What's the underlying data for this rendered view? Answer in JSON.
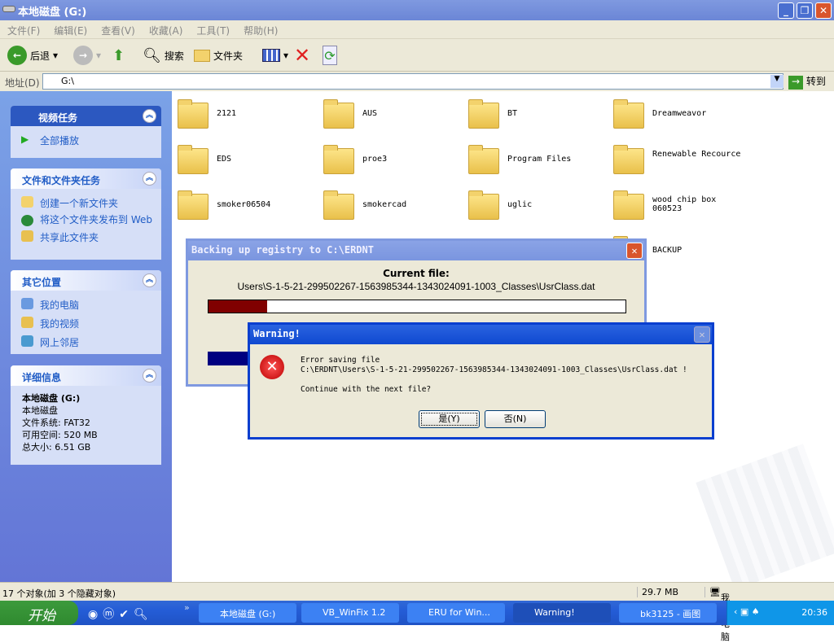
{
  "window": {
    "title": "本地磁盘 (G:)"
  },
  "menu": [
    "文件(F)",
    "编辑(E)",
    "查看(V)",
    "收藏(A)",
    "工具(T)",
    "帮助(H)"
  ],
  "toolbar": {
    "back": "后退",
    "search": "搜索",
    "folders": "文件夹"
  },
  "address": {
    "label": "地址(D)",
    "value": "G:\\",
    "go": "转到"
  },
  "sidebar": {
    "video_tasks": {
      "title": "视频任务",
      "items": [
        "全部播放"
      ]
    },
    "file_tasks": {
      "title": "文件和文件夹任务",
      "items": [
        "创建一个新文件夹",
        "将这个文件夹发布到 Web",
        "共享此文件夹"
      ]
    },
    "other_places": {
      "title": "其它位置",
      "items": [
        "我的电脑",
        "我的视频",
        "网上邻居"
      ]
    },
    "details": {
      "title": "详细信息",
      "name": "本地磁盘 (G:)",
      "type": "本地磁盘",
      "fs": "文件系统: FAT32",
      "free": "可用空间: 520 MB",
      "total": "总大小: 6.51 GB"
    }
  },
  "folders": [
    "2121",
    "AUS",
    "BT",
    "Dreamweavor",
    "EDS",
    "proe3",
    "Program Files",
    "Renewable Recource",
    "smoker06504",
    "smokercad",
    "uglic",
    "wood chip box 060523",
    "BACKUP"
  ],
  "backup_dialog": {
    "title": "Backing up registry to C:\\ERDNT",
    "current_label": "Current file:",
    "current_file": "Users\\S-1-5-21-299502267-1563985344-1343024091-1003_Classes\\UsrClass.dat",
    "progress_percent": 14
  },
  "warning_dialog": {
    "title": "Warning!",
    "line1": "Error saving file",
    "line2": "C:\\ERDNT\\Users\\S-1-5-21-299502267-1563985344-1343024091-1003_Classes\\UsrClass.dat !",
    "line3": "Continue with the next file?",
    "yes": "是(Y)",
    "no": "否(N)"
  },
  "status": {
    "objects": "17 个对象(加 3 个隐藏对象)",
    "size": "29.7 MB",
    "location": "我的电脑"
  },
  "taskbar": {
    "start": "开始",
    "tasks": [
      "本地磁盘 (G:)",
      "VB_WinFix 1.2",
      "ERU for Win...",
      "Warning!",
      "bk3125 - 画图"
    ],
    "clock": "20:36"
  }
}
